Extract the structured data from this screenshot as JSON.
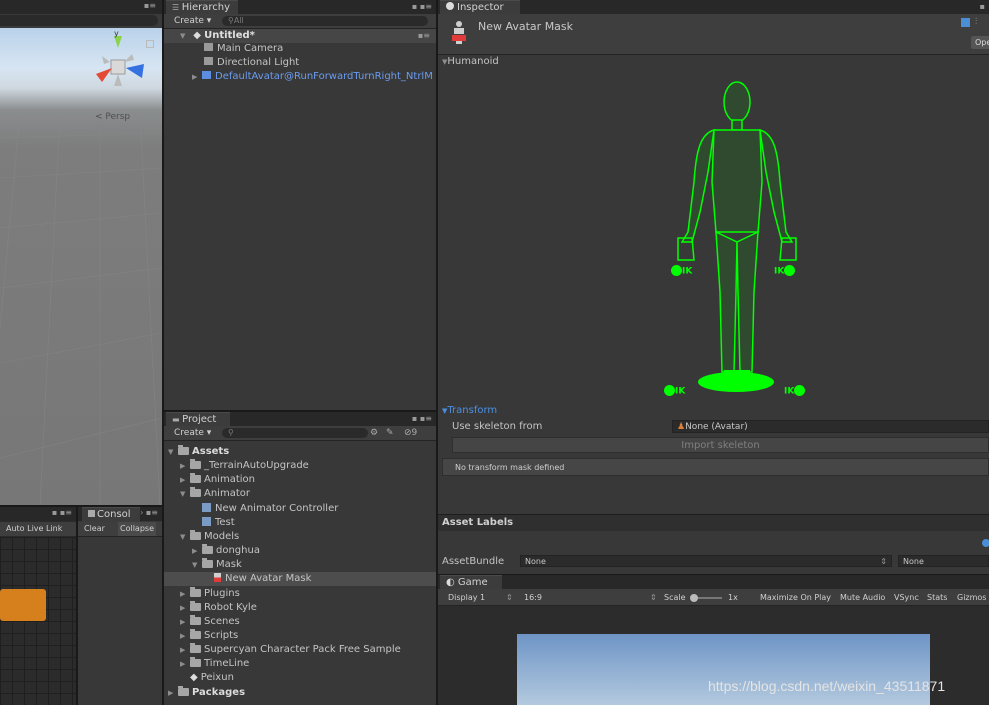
{
  "scene": {
    "persp_label": "< Persp",
    "gizmo_y": "y"
  },
  "animator": {
    "auto_live_link": "Auto Live Link"
  },
  "console": {
    "tab": "Consol",
    "clear": "Clear",
    "collapse": "Collapse"
  },
  "hierarchy": {
    "tab": "Hierarchy",
    "create": "Create ▾",
    "search_placeholder": "All",
    "scene_name": "Untitled*",
    "items": [
      "Main Camera",
      "Directional Light",
      "DefaultAvatar@RunForwardTurnRight_NtrlM"
    ]
  },
  "project": {
    "tab": "Project",
    "create": "Create ▾",
    "hidden_count": "9",
    "tree": [
      {
        "label": "Assets",
        "depth": 0,
        "arrow": "▼",
        "icon": "folder",
        "bold": true
      },
      {
        "label": "_TerrainAutoUpgrade",
        "depth": 1,
        "arrow": "▶",
        "icon": "folder"
      },
      {
        "label": "Animation",
        "depth": 1,
        "arrow": "▶",
        "icon": "folder"
      },
      {
        "label": "Animator",
        "depth": 1,
        "arrow": "▼",
        "icon": "folder"
      },
      {
        "label": "New Animator Controller",
        "depth": 2,
        "arrow": "",
        "icon": "controller"
      },
      {
        "label": "Test",
        "depth": 2,
        "arrow": "",
        "icon": "controller"
      },
      {
        "label": "Models",
        "depth": 1,
        "arrow": "▼",
        "icon": "folder"
      },
      {
        "label": "donghua",
        "depth": 2,
        "arrow": "▶",
        "icon": "folder"
      },
      {
        "label": "Mask",
        "depth": 2,
        "arrow": "▼",
        "icon": "folder"
      },
      {
        "label": "New Avatar Mask",
        "depth": 3,
        "arrow": "",
        "icon": "mask",
        "selected": true
      },
      {
        "label": "Plugins",
        "depth": 1,
        "arrow": "▶",
        "icon": "folder"
      },
      {
        "label": "Robot Kyle",
        "depth": 1,
        "arrow": "▶",
        "icon": "folder"
      },
      {
        "label": "Scenes",
        "depth": 1,
        "arrow": "▶",
        "icon": "folder"
      },
      {
        "label": "Scripts",
        "depth": 1,
        "arrow": "▶",
        "icon": "folder"
      },
      {
        "label": "Supercyan Character Pack Free Sample",
        "depth": 1,
        "arrow": "▶",
        "icon": "folder"
      },
      {
        "label": "TimeLine",
        "depth": 1,
        "arrow": "▶",
        "icon": "folder"
      },
      {
        "label": "Peixun",
        "depth": 1,
        "arrow": "",
        "icon": "unity"
      },
      {
        "label": "Packages",
        "depth": 0,
        "arrow": "▶",
        "icon": "folder",
        "bold": true
      }
    ]
  },
  "inspector": {
    "tab": "Inspector",
    "title": "New Avatar Mask",
    "open_btn": "Ope",
    "humanoid_header": "Humanoid",
    "ik_label": "IK",
    "transform_header": "Transform",
    "use_skeleton_label": "Use skeleton from",
    "use_skeleton_value": "None (Avatar)",
    "import_skeleton": "Import skeleton",
    "no_transform": "No transform mask defined",
    "accent": "#00ff00"
  },
  "asset_labels": {
    "header": "Asset Labels",
    "assetbundle_label": "AssetBundle",
    "assetbundle_value": "None",
    "variant_value": "None"
  },
  "game": {
    "tab": "Game",
    "display": "Display 1",
    "aspect": "16:9",
    "scale_label": "Scale",
    "scale_value": "1x",
    "buttons": [
      "Maximize On Play",
      "Mute Audio",
      "VSync",
      "Stats",
      "Gizmos"
    ]
  },
  "watermark": "https://blog.csdn.net/weixin_43511871"
}
